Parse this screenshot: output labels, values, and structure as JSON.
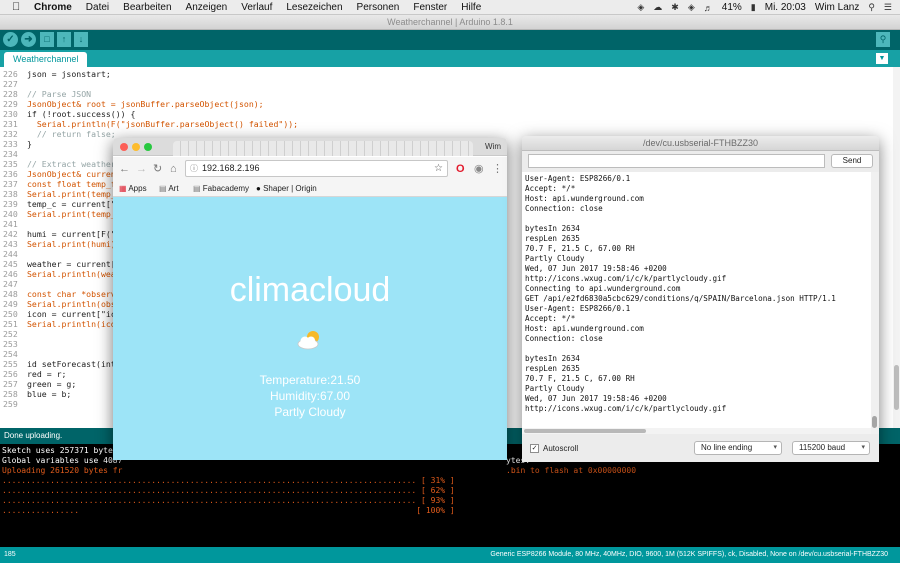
{
  "menubar": {
    "app": "Chrome",
    "items": [
      "Datei",
      "Bearbeiten",
      "Anzeigen",
      "Verlauf",
      "Lesezeichen",
      "Personen",
      "Fenster",
      "Hilfe"
    ],
    "battery": "41%",
    "clock": "Mi. 20:03",
    "user": "Wim Lanz"
  },
  "arduino": {
    "window_title": "Weatherchannel | Arduino 1.8.1",
    "tab": "Weatherchannel",
    "code_lines": [
      {
        "n": "226",
        "t": "json = jsonstart;"
      },
      {
        "n": "227",
        "t": ""
      },
      {
        "n": "228",
        "t": "// Parse JSON"
      },
      {
        "n": "229",
        "t": "JsonObject& root = jsonBuffer.parseObject(json);"
      },
      {
        "n": "230",
        "t": "if (!root.success()) {"
      },
      {
        "n": "231",
        "t": "  Serial.println(F(\"jsonBuffer.parseObject() failed\"));"
      },
      {
        "n": "232",
        "t": "  // return false;"
      },
      {
        "n": "233",
        "t": "}"
      },
      {
        "n": "234",
        "t": ""
      },
      {
        "n": "235",
        "t": "// Extract weather"
      },
      {
        "n": "236",
        "t": "JsonObject& current"
      },
      {
        "n": "237",
        "t": "const float temp_f"
      },
      {
        "n": "238",
        "t": "Serial.print(temp_f"
      },
      {
        "n": "239",
        "t": "temp_c = current[\"te"
      },
      {
        "n": "240",
        "t": "Serial.print(temp_c"
      },
      {
        "n": "241",
        "t": ""
      },
      {
        "n": "242",
        "t": "humi = current[F(\"re"
      },
      {
        "n": "243",
        "t": "Serial.print(humi);"
      },
      {
        "n": "244",
        "t": ""
      },
      {
        "n": "245",
        "t": "weather = current[\"w"
      },
      {
        "n": "246",
        "t": "Serial.println(weath"
      },
      {
        "n": "247",
        "t": ""
      },
      {
        "n": "248",
        "t": "const char *observat"
      },
      {
        "n": "249",
        "t": "Serial.println(obser"
      },
      {
        "n": "250",
        "t": "icon = current[\"icon"
      },
      {
        "n": "251",
        "t": "Serial.println(icon)"
      },
      {
        "n": "252",
        "t": ""
      },
      {
        "n": "253",
        "t": ""
      },
      {
        "n": "254",
        "t": ""
      },
      {
        "n": "255",
        "t": "id setForecast(int r"
      },
      {
        "n": "256",
        "t": "red = r;"
      },
      {
        "n": "257",
        "t": "green = g;"
      },
      {
        "n": "258",
        "t": "blue = b;"
      },
      {
        "n": "259",
        "t": ""
      }
    ],
    "status": "Done uploading.",
    "console_lines": [
      {
        "t": "Sketch uses 257371 bytes (",
        "c": "#ffffff"
      },
      {
        "t": "Global variables use 4087",
        "c": "#ffffff"
      },
      {
        "t": "Uploading 261520 bytes fr",
        "c": "#e25c1c"
      },
      {
        "t": "...................................................................................... [ 31% ]",
        "c": "#e25c1c"
      },
      {
        "t": "...................................................................................... [ 62% ]",
        "c": "#e25c1c"
      },
      {
        "t": "...................................................................................... [ 93% ]",
        "c": "#e25c1c"
      },
      {
        "t": "................                                                                      [ 100% ]",
        "c": "#e25c1c"
      }
    ],
    "console_tail_1": "ytes.",
    "console_tail_2": ".bin to flash at 0x00000000",
    "footer_line": "185",
    "footer_board": "Generic ESP8266 Module, 80 MHz, 40MHz, DIO, 9600, 1M (512K SPIFFS), ck, Disabled, None on /dev/cu.usbserial-FTHBZZ30"
  },
  "chrome": {
    "user": "Wim",
    "url": "192.168.2.196",
    "bookmarks": [
      "Apps",
      "Art",
      "Fabacademy",
      "Shaper | Origin"
    ],
    "page": {
      "heading": "climacloud",
      "temperature": "Temperature:21.50",
      "humidity": "Humidity:67.00",
      "condition": "Partly Cloudy"
    }
  },
  "serial": {
    "title": "/dev/cu.usbserial-FTHBZZ30",
    "send_label": "Send",
    "output_lines": [
      "User-Agent: ESP8266/0.1",
      "Accept: */*",
      "Host: api.wunderground.com",
      "Connection: close",
      "",
      "bytesIn 2634",
      "respLen 2635",
      "70.7 F, 21.5 C, 67.00 RH",
      "Partly Cloudy",
      "Wed, 07 Jun 2017 19:58:46 +0200",
      "http://icons.wxug.com/i/c/k/partlycloudy.gif",
      "Connecting to api.wunderground.com",
      "GET /api/e2fd6830a5cbc629/conditions/q/SPAIN/Barcelona.json HTTP/1.1",
      "User-Agent: ESP8266/0.1",
      "Accept: */*",
      "Host: api.wunderground.com",
      "Connection: close",
      "",
      "bytesIn 2634",
      "respLen 2635",
      "70.7 F, 21.5 C, 67.00 RH",
      "Partly Cloudy",
      "Wed, 07 Jun 2017 19:58:46 +0200",
      "http://icons.wxug.com/i/c/k/partlycloudy.gif"
    ],
    "autoscroll_label": "Autoscroll",
    "line_ending": "No line ending",
    "baud": "115200 baud"
  }
}
